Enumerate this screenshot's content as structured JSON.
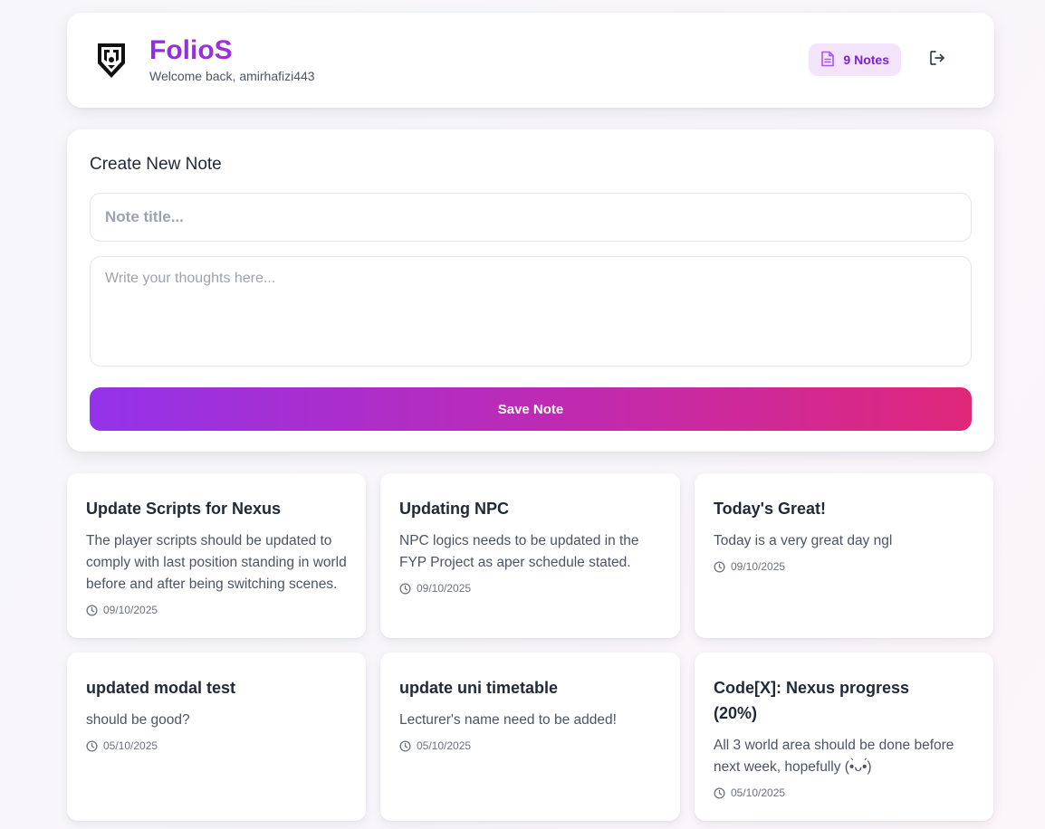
{
  "header": {
    "brand": "FolioS",
    "welcome": "Welcome back, amirhafizi443",
    "notes_count_label": "9 Notes"
  },
  "create": {
    "heading": "Create New Note",
    "title_placeholder": "Note title...",
    "body_placeholder": "Write your thoughts here...",
    "save_label": "Save Note"
  },
  "notes": [
    {
      "title": "Update Scripts for Nexus",
      "body": "The player scripts should be updated to comply with last position standing in world before and after being switching scenes.",
      "date": "09/10/2025"
    },
    {
      "title": "Updating NPC",
      "body": "NPC logics needs to be updated in the FYP Project as aper schedule stated.",
      "date": "09/10/2025"
    },
    {
      "title": "Today's Great!",
      "body": "Today is a very great day ngl",
      "date": "09/10/2025"
    },
    {
      "title": "updated modal test",
      "body": "should be good?",
      "date": "05/10/2025"
    },
    {
      "title": "update uni timetable",
      "body": "Lecturer's name need to be added!",
      "date": "05/10/2025"
    },
    {
      "title": "Code[X]: Nexus progress (20%)",
      "body": "All 3 world area should be done before next week, hopefully (•̀ᴗ•́)",
      "date": "05/10/2025"
    }
  ],
  "colors": {
    "brand_purple": "#9333ea",
    "brand_pink": "#e0287a",
    "badge_bg": "#f3e3fb"
  },
  "icons": {
    "logo": "shield-logo",
    "badge": "document-icon",
    "logout": "logout-icon",
    "date": "clock-icon"
  }
}
